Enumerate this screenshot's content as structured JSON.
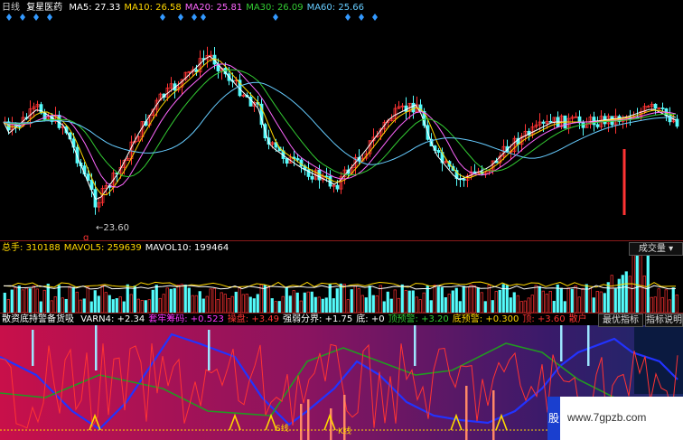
{
  "main": {
    "period": "日线",
    "stock_name": "复星医药",
    "ma": [
      {
        "label": "MA5:",
        "value": "27.33",
        "color": "#ffffff"
      },
      {
        "label": "MA10:",
        "value": "26.58",
        "color": "#ffd700"
      },
      {
        "label": "MA20:",
        "value": "25.81",
        "color": "#ff66ff"
      },
      {
        "label": "MA30:",
        "value": "26.09",
        "color": "#33cc33"
      },
      {
        "label": "MA60:",
        "value": "25.66",
        "color": "#66ccff"
      }
    ],
    "low_price_label": "23.60"
  },
  "volume": {
    "items": [
      {
        "label": "总手:",
        "value": "310188",
        "color": "#ffd700"
      },
      {
        "label": "MAVOL5:",
        "value": "259639",
        "color": "#ffd700"
      },
      {
        "label": "MAVOL10:",
        "value": "199464",
        "color": "#ffffff"
      }
    ],
    "indicator_button": "成交量"
  },
  "indicator": {
    "title": "散资底持警备货吸",
    "items": [
      {
        "label": "VARN4:",
        "value": "+2.34",
        "color": "#ffffff"
      },
      {
        "label": "套牢筹码:",
        "value": "+0.523",
        "color": "#ff33ff"
      },
      {
        "label": "操盘:",
        "value": "+3.49",
        "color": "#ff3333"
      },
      {
        "label": "强弱分界:",
        "value": "+1.75",
        "color": "#ffffff"
      },
      {
        "label": "底:",
        "value": "+0",
        "color": "#ffffff"
      },
      {
        "label": "顶预警:",
        "value": "+3.20",
        "color": "#33cc33"
      },
      {
        "label": "底预警:",
        "value": "+0.300",
        "color": "#ffd700"
      },
      {
        "label": "顶:",
        "value": "+3.60",
        "color": "#ff3333"
      },
      {
        "label": "散户",
        "value": "",
        "color": "#ff3333"
      }
    ],
    "buttons": {
      "best": "最优指标",
      "help": "指标说明"
    },
    "line_label_1": "S线",
    "line_label_2": "K线"
  },
  "watermark": {
    "text": "www.7gpzb.com",
    "logo_text": "股"
  },
  "colors": {
    "up": "#ff3333",
    "down": "#54fcfc",
    "bg": "#000000"
  }
}
